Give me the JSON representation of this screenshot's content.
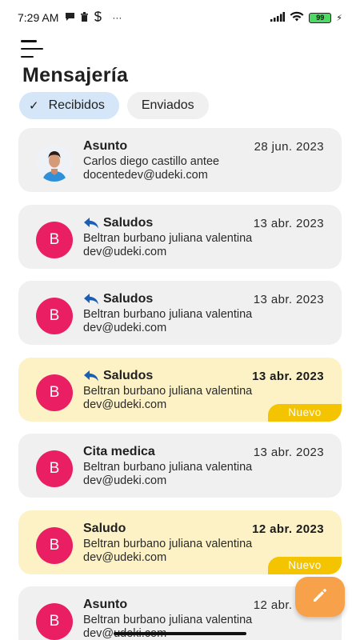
{
  "status_bar": {
    "time": "7:29 AM",
    "left_icons": [
      "chat-bubble-icon",
      "trash-icon",
      "s-icon",
      "more-dots-icon"
    ],
    "more": "···",
    "battery": "99"
  },
  "header": {
    "title": "Mensajería"
  },
  "tabs": [
    {
      "label": "Recibidos",
      "selected": true,
      "check": "✓"
    },
    {
      "label": "Enviados",
      "selected": false
    }
  ],
  "messages": [
    {
      "subject": "Asunto",
      "replied": false,
      "date": "28 jun. 2023",
      "sender": "Carlos diego castillo antee",
      "email": "docentedev@udeki.com",
      "avatar": "photo",
      "unread": false
    },
    {
      "subject": "Saludos",
      "replied": true,
      "date": "13 abr. 2023",
      "sender": "Beltran burbano juliana valentina",
      "email": "dev@udeki.com",
      "avatar": "B",
      "unread": false
    },
    {
      "subject": "Saludos",
      "replied": true,
      "date": "13 abr. 2023",
      "sender": "Beltran burbano juliana valentina",
      "email": "dev@udeki.com",
      "avatar": "B",
      "unread": false
    },
    {
      "subject": "Saludos",
      "replied": true,
      "date": "13 abr. 2023",
      "sender": "Beltran burbano juliana valentina",
      "email": "dev@udeki.com",
      "avatar": "B",
      "unread": true,
      "badge": "Nuevo"
    },
    {
      "subject": "Cita medica",
      "replied": false,
      "date": "13 abr. 2023",
      "sender": "Beltran burbano juliana valentina",
      "email": "dev@udeki.com",
      "avatar": "B",
      "unread": false
    },
    {
      "subject": "Saludo",
      "replied": false,
      "date": "12 abr. 2023",
      "sender": "Beltran burbano juliana valentina",
      "email": "dev@udeki.com",
      "avatar": "B",
      "unread": true,
      "badge": "Nuevo"
    },
    {
      "subject": "Asunto",
      "replied": false,
      "date": "12 abr. 2023",
      "sender": "Beltran burbano juliana valentina",
      "email": "dev@udeki.com",
      "avatar": "B",
      "unread": false
    }
  ],
  "fab": {
    "icon": "pencil-icon"
  },
  "colors": {
    "avatar": "#e91e63",
    "unread_card": "#fdf2c6",
    "read_card": "#f0f0f0",
    "badge": "#f5c400",
    "fab": "#f7a14a",
    "selected_chip": "#d5e6f9",
    "reply_icon": "#1a5fb4"
  }
}
